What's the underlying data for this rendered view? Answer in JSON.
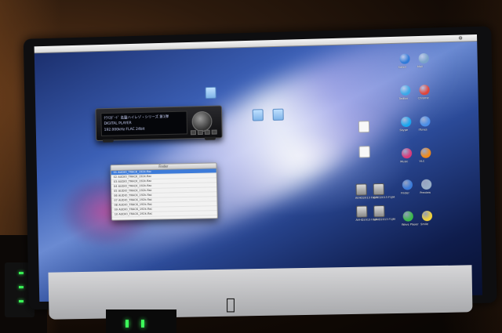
{
  "scene": {
    "menubar": {
      "glyph": "⚙"
    },
    "player": {
      "line1": "ｸﾗﾘｽﾀﾞｰﾄﾞ 名盤ハイレゾ・シリーズ 第1弾",
      "line2": "DIGITAL PLAYER",
      "line3": "192.000kHz  FLAC 24bit"
    },
    "finder": {
      "title": "Finder",
      "rows": [
        "01 AUDIO_TRACK_192k.flac",
        "02 AUDIO_TRACK_192k.flac",
        "03 AUDIO_TRACK_192k.flac",
        "04 AUDIO_TRACK_192k.flac",
        "05 AUDIO_TRACK_192k.flac",
        "06 AUDIO_TRACK_192k.flac",
        "07 AUDIO_TRACK_192k.flac",
        "08 AUDIO_TRACK_192k.flac",
        "09 AUDIO_TRACK_192k.flac",
        "10 AUDIO_TRACK_192k.flac"
      ]
    },
    "desktop_icons": [
      {
        "label": "",
        "kind": "folder"
      },
      {
        "label": "",
        "kind": "folder"
      },
      {
        "label": "",
        "kind": "folder"
      },
      {
        "label": "",
        "kind": "doc"
      },
      {
        "label": "",
        "kind": "doc"
      },
      {
        "label": "AVHD2013 F1JM",
        "kind": "thumb"
      },
      {
        "label": "AVHD2013 F1JM",
        "kind": "thumb"
      },
      {
        "label": "AVHD2013 F1JM",
        "kind": "thumb"
      },
      {
        "label": "AVHD2013 F1JM",
        "kind": "thumb"
      }
    ],
    "right_apps": [
      {
        "label": "Safari",
        "color": "#2f7ad8"
      },
      {
        "label": "Mail",
        "color": "#7aa3c9"
      },
      {
        "label": "Twitter",
        "color": "#3aa8e8"
      },
      {
        "label": "Chrome",
        "color": "#e0453a"
      },
      {
        "label": "Skype",
        "color": "#19a7ef"
      },
      {
        "label": "iTunes",
        "color": "#4a8ee8"
      },
      {
        "label": "Music",
        "color": "#d83a7a"
      },
      {
        "label": "VLC",
        "color": "#f08a1a"
      },
      {
        "label": "Finder",
        "color": "#3a7ad8"
      },
      {
        "label": "Preview",
        "color": "#9ab0c8"
      },
      {
        "label": "Wave Player",
        "color": "#3ab84a"
      },
      {
        "label": "Smile",
        "color": "#f2d23a"
      }
    ],
    "dock_colors": [
      "#2e6fd6",
      "#d8d8d8",
      "#f2b21a",
      "#3aa34a",
      "#e24a3a",
      "#7a4ac2",
      "#3ab8e0",
      "#e0e0e0",
      "#c23a8a",
      "#4a9a3a",
      "#1a8ad8",
      "#f28a1a",
      "#5a5a5a",
      "#d8c23a",
      "#3a5ab8",
      "#e83a3a",
      "#8ac23a",
      "#2ab8a8",
      "#c8c8c8",
      "#a83ae0",
      "#f2f2f2",
      "#e05a8a",
      "#3a8ae0",
      "#d8a83a",
      "#6a6a6a",
      "#4ae0a8",
      "#e8e8e8"
    ]
  }
}
